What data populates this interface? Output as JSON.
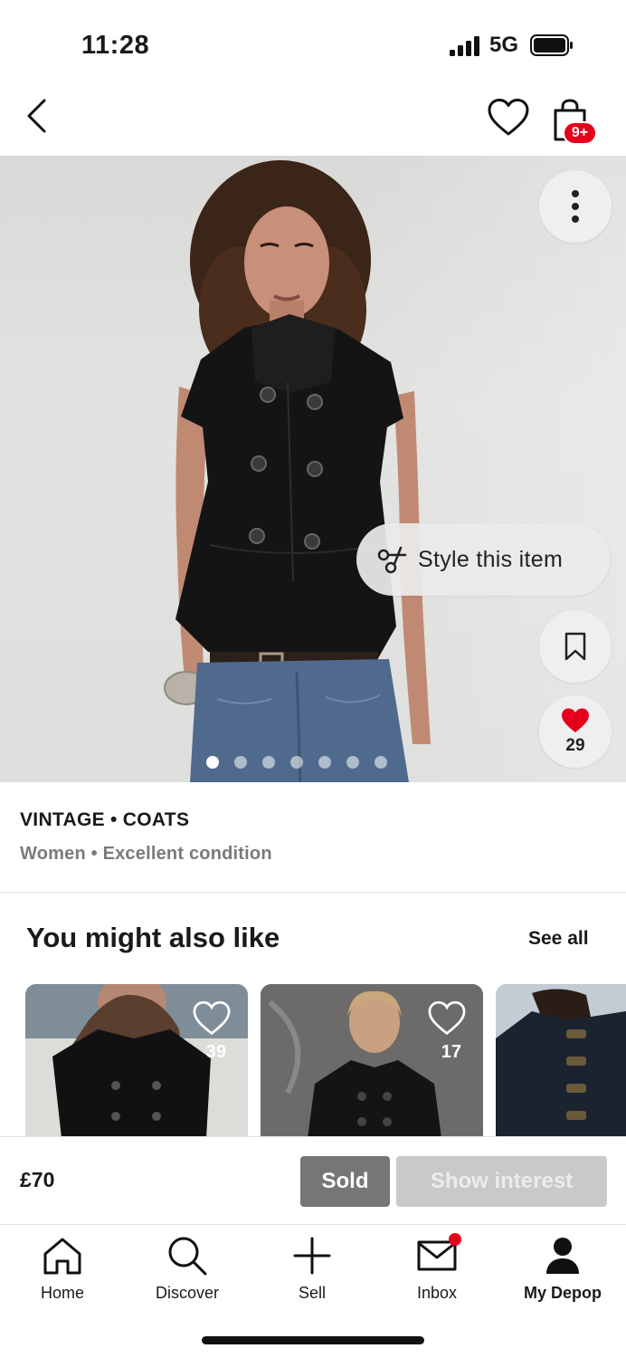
{
  "status_bar": {
    "time": "11:28",
    "network": "5G"
  },
  "top_nav": {
    "bag_badge": "9+"
  },
  "image": {
    "style_pill_label": "Style this item",
    "likes_count": "29",
    "dots_total": 7,
    "active_dot": 0
  },
  "item": {
    "category": "VINTAGE • COATS",
    "subline": "Women • Excellent condition"
  },
  "recommendations": {
    "title": "You might also like",
    "see_all": "See all",
    "cards": [
      {
        "likes": "39"
      },
      {
        "likes": "17"
      },
      {
        "likes": ""
      }
    ]
  },
  "buy_bar": {
    "price": "£70",
    "sold_label": "Sold",
    "interest_label": "Show interest"
  },
  "tabs": [
    {
      "label": "Home",
      "icon": "home-icon"
    },
    {
      "label": "Discover",
      "icon": "search-icon"
    },
    {
      "label": "Sell",
      "icon": "plus-icon"
    },
    {
      "label": "Inbox",
      "icon": "mail-icon"
    },
    {
      "label": "My Depop",
      "icon": "profile-icon"
    }
  ],
  "colors": {
    "accent_red": "#e6001c",
    "sold_grey": "#767676",
    "disabled_grey": "#c9c9c9"
  }
}
